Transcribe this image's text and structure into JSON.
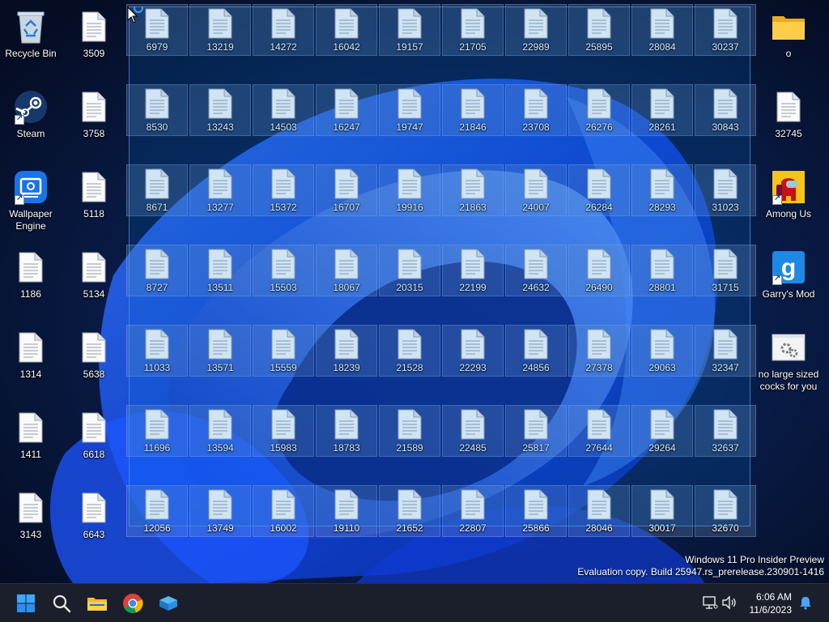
{
  "desktop": {
    "left_icons": [
      {
        "label": "Recycle Bin",
        "icon": "recycle-bin-icon",
        "col": 0,
        "row": 0
      },
      {
        "label": "Steam",
        "icon": "steam-icon",
        "col": 0,
        "row": 1,
        "shortcut": true
      },
      {
        "label": "Wallpaper Engine",
        "icon": "wallpaper-engine-icon",
        "col": 0,
        "row": 2,
        "shortcut": true
      },
      {
        "label": "1186",
        "icon": "file-icon",
        "col": 0,
        "row": 3
      },
      {
        "label": "1314",
        "icon": "file-icon",
        "col": 0,
        "row": 4
      },
      {
        "label": "1411",
        "icon": "file-icon",
        "col": 0,
        "row": 5
      },
      {
        "label": "3143",
        "icon": "file-icon",
        "col": 0,
        "row": 6
      },
      {
        "label": "3509",
        "icon": "file-icon",
        "col": 1,
        "row": 0
      },
      {
        "label": "3758",
        "icon": "file-icon",
        "col": 1,
        "row": 1
      },
      {
        "label": "5118",
        "icon": "file-icon",
        "col": 1,
        "row": 2
      },
      {
        "label": "5134",
        "icon": "file-icon",
        "col": 1,
        "row": 3
      },
      {
        "label": "5638",
        "icon": "file-icon",
        "col": 1,
        "row": 4
      },
      {
        "label": "6618",
        "icon": "file-icon",
        "col": 1,
        "row": 5
      },
      {
        "label": "6643",
        "icon": "file-icon",
        "col": 1,
        "row": 6
      }
    ],
    "selected_columns": [
      [
        "6979",
        "8530",
        "8671",
        "8727",
        "11033",
        "11696",
        "12056"
      ],
      [
        "13219",
        "13243",
        "13277",
        "13511",
        "13571",
        "13594",
        "13749"
      ],
      [
        "14272",
        "14503",
        "15372",
        "15503",
        "15559",
        "15983",
        "16002"
      ],
      [
        "16042",
        "16247",
        "16707",
        "18067",
        "18239",
        "18783",
        "19110"
      ],
      [
        "19157",
        "19747",
        "19916",
        "20315",
        "21528",
        "21589",
        "21652"
      ],
      [
        "21705",
        "21846",
        "21863",
        "22199",
        "22293",
        "22485",
        "22807"
      ],
      [
        "22989",
        "23708",
        "24007",
        "24632",
        "24856",
        "25817",
        "25866"
      ],
      [
        "25895",
        "26276",
        "26284",
        "26490",
        "27378",
        "27644",
        "28046"
      ],
      [
        "28084",
        "28261",
        "28293",
        "28801",
        "29063",
        "29264",
        "30017"
      ],
      [
        "30237",
        "30843",
        "31023",
        "31715",
        "32347",
        "32637",
        "32670"
      ]
    ],
    "right_icons": [
      {
        "label": "o",
        "icon": "folder-icon",
        "row": 0
      },
      {
        "label": "32745",
        "icon": "file-icon",
        "row": 1
      },
      {
        "label": "Among Us",
        "icon": "among-us-icon",
        "row": 2,
        "shortcut": true
      },
      {
        "label": "Garry's Mod",
        "icon": "garrys-mod-icon",
        "row": 3,
        "shortcut": true
      },
      {
        "label": "no large sized cocks for you",
        "icon": "settings-file-icon",
        "row": 4
      }
    ]
  },
  "watermark": {
    "line1": "Windows 11 Pro Insider Preview",
    "line2": "Evaluation copy. Build 25947.rs_prerelease.230901-1416"
  },
  "taskbar": {
    "pinned": [
      {
        "name": "start-button",
        "icon": "windows-logo-icon"
      },
      {
        "name": "search-button",
        "icon": "search-icon"
      },
      {
        "name": "file-explorer-button",
        "icon": "folder-icon"
      },
      {
        "name": "chrome-button",
        "icon": "chrome-icon"
      },
      {
        "name": "sandbox-button",
        "icon": "sandbox-icon"
      }
    ],
    "time": "6:06 AM",
    "date": "11/6/2023"
  },
  "colors": {
    "accent": "#0078d7",
    "taskbar_bg": "#1b1f2b",
    "wallpaper_bg": "#07122b",
    "bloom_blue": "#1a5cff"
  }
}
